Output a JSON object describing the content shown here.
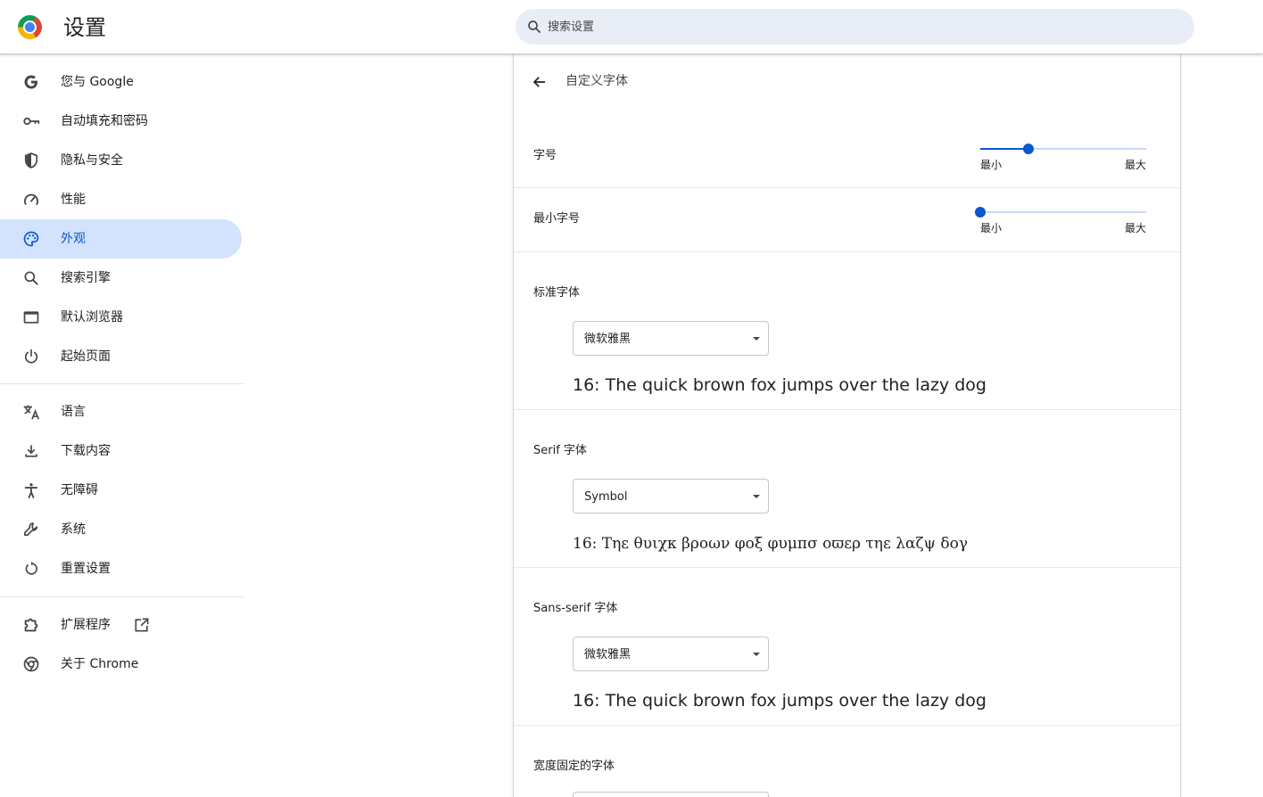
{
  "header": {
    "title": "设置",
    "search_placeholder": "搜索设置"
  },
  "sidebar": {
    "items": [
      {
        "label": "您与 Google",
        "icon": "google-g-icon"
      },
      {
        "label": "自动填充和密码",
        "icon": "key-icon"
      },
      {
        "label": "隐私与安全",
        "icon": "shield-icon"
      },
      {
        "label": "性能",
        "icon": "speedometer-icon"
      },
      {
        "label": "外观",
        "icon": "palette-icon",
        "active": true
      },
      {
        "label": "搜索引擎",
        "icon": "search-icon"
      },
      {
        "label": "默认浏览器",
        "icon": "browser-window-icon"
      },
      {
        "label": "起始页面",
        "icon": "power-icon"
      },
      {
        "label": "语言",
        "icon": "translate-icon"
      },
      {
        "label": "下载内容",
        "icon": "download-icon"
      },
      {
        "label": "无障碍",
        "icon": "accessibility-icon"
      },
      {
        "label": "系统",
        "icon": "wrench-icon"
      },
      {
        "label": "重置设置",
        "icon": "reset-icon"
      },
      {
        "label": "扩展程序",
        "icon": "puzzle-icon",
        "external": true
      },
      {
        "label": "关于 Chrome",
        "icon": "chrome-icon"
      }
    ]
  },
  "main": {
    "subpage_title": "自定义字体",
    "font_size": {
      "label": "字号",
      "min_label": "最小",
      "max_label": "最大",
      "value_fraction": 0.29
    },
    "minimum_font_size": {
      "label": "最小字号",
      "min_label": "最小",
      "max_label": "最大",
      "value_fraction": 0.0
    },
    "standard_font": {
      "label": "标准字体",
      "selected": "微软雅黑",
      "sample": "16: The quick brown fox jumps over the lazy dog"
    },
    "serif_font": {
      "label": "Serif 字体",
      "selected": "Symbol",
      "sample": "16: Τηε θυιχκ βροων φοξ φυμπσ οϖερ τηε λαζψ δογ"
    },
    "sans_serif_font": {
      "label": "Sans-serif 字体",
      "selected": "微软雅黑",
      "sample": "16: The quick brown fox jumps over the lazy dog"
    },
    "fixed_width_font": {
      "label": "宽度固定的字体"
    }
  },
  "colors": {
    "accent": "#0b57d0",
    "active_nav_bg": "#d3e3fd",
    "search_bg": "#e9eef6"
  }
}
